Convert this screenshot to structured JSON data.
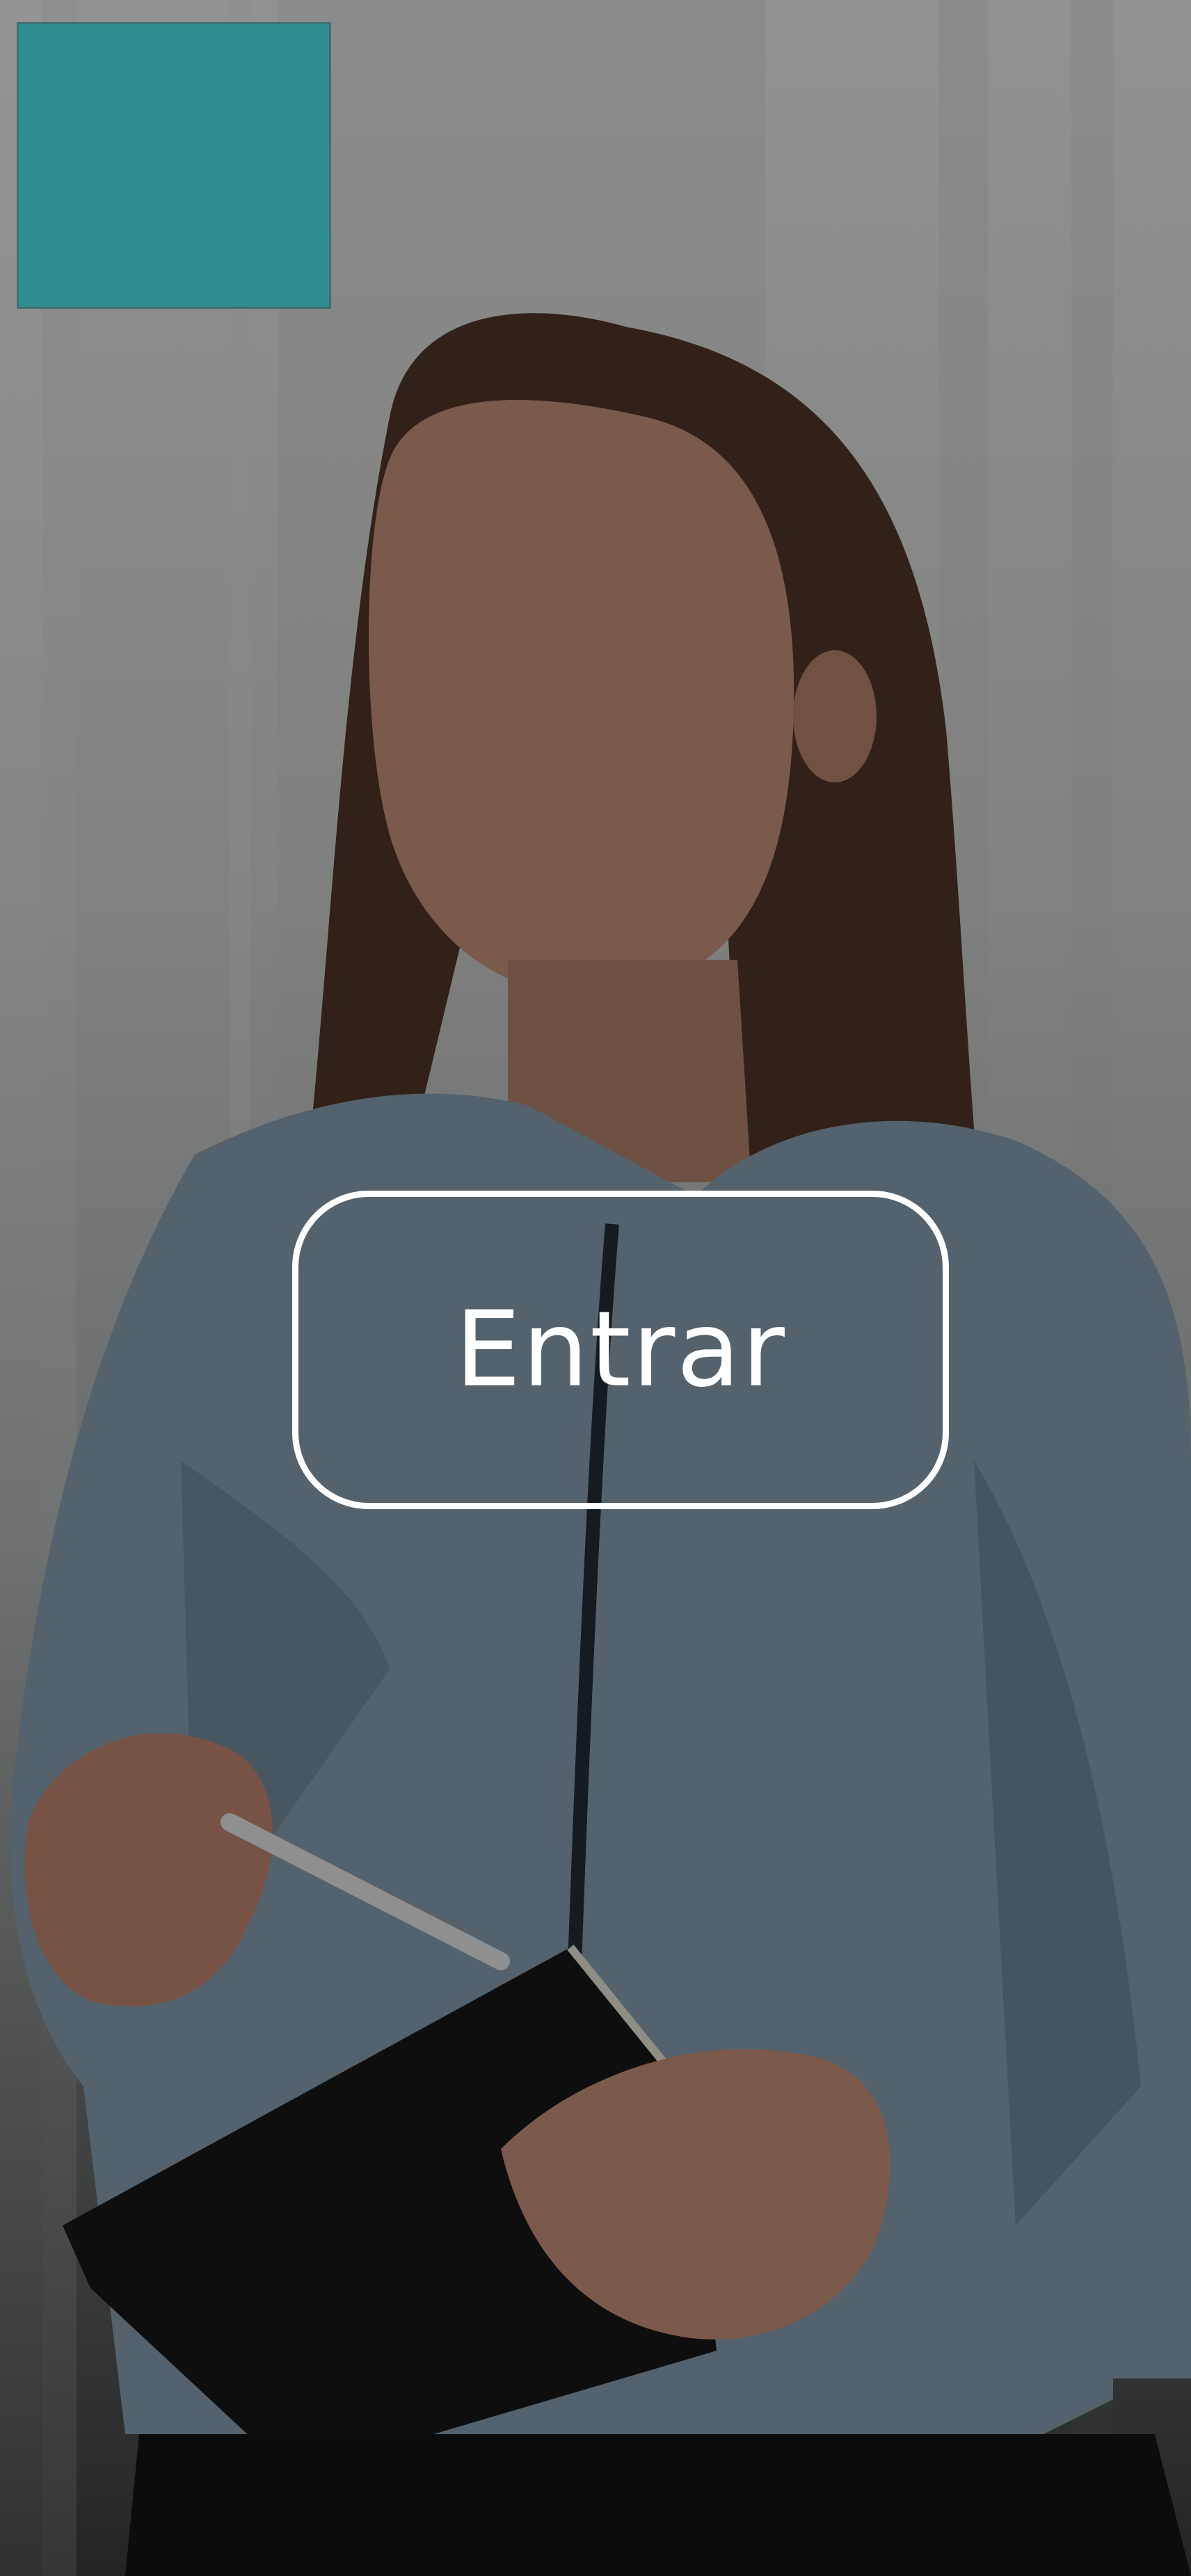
{
  "enter_button": {
    "label": "Entrar"
  },
  "colors": {
    "logo_fill": "#2f8e8f",
    "button_border": "#ffffff",
    "button_text": "#ffffff"
  }
}
